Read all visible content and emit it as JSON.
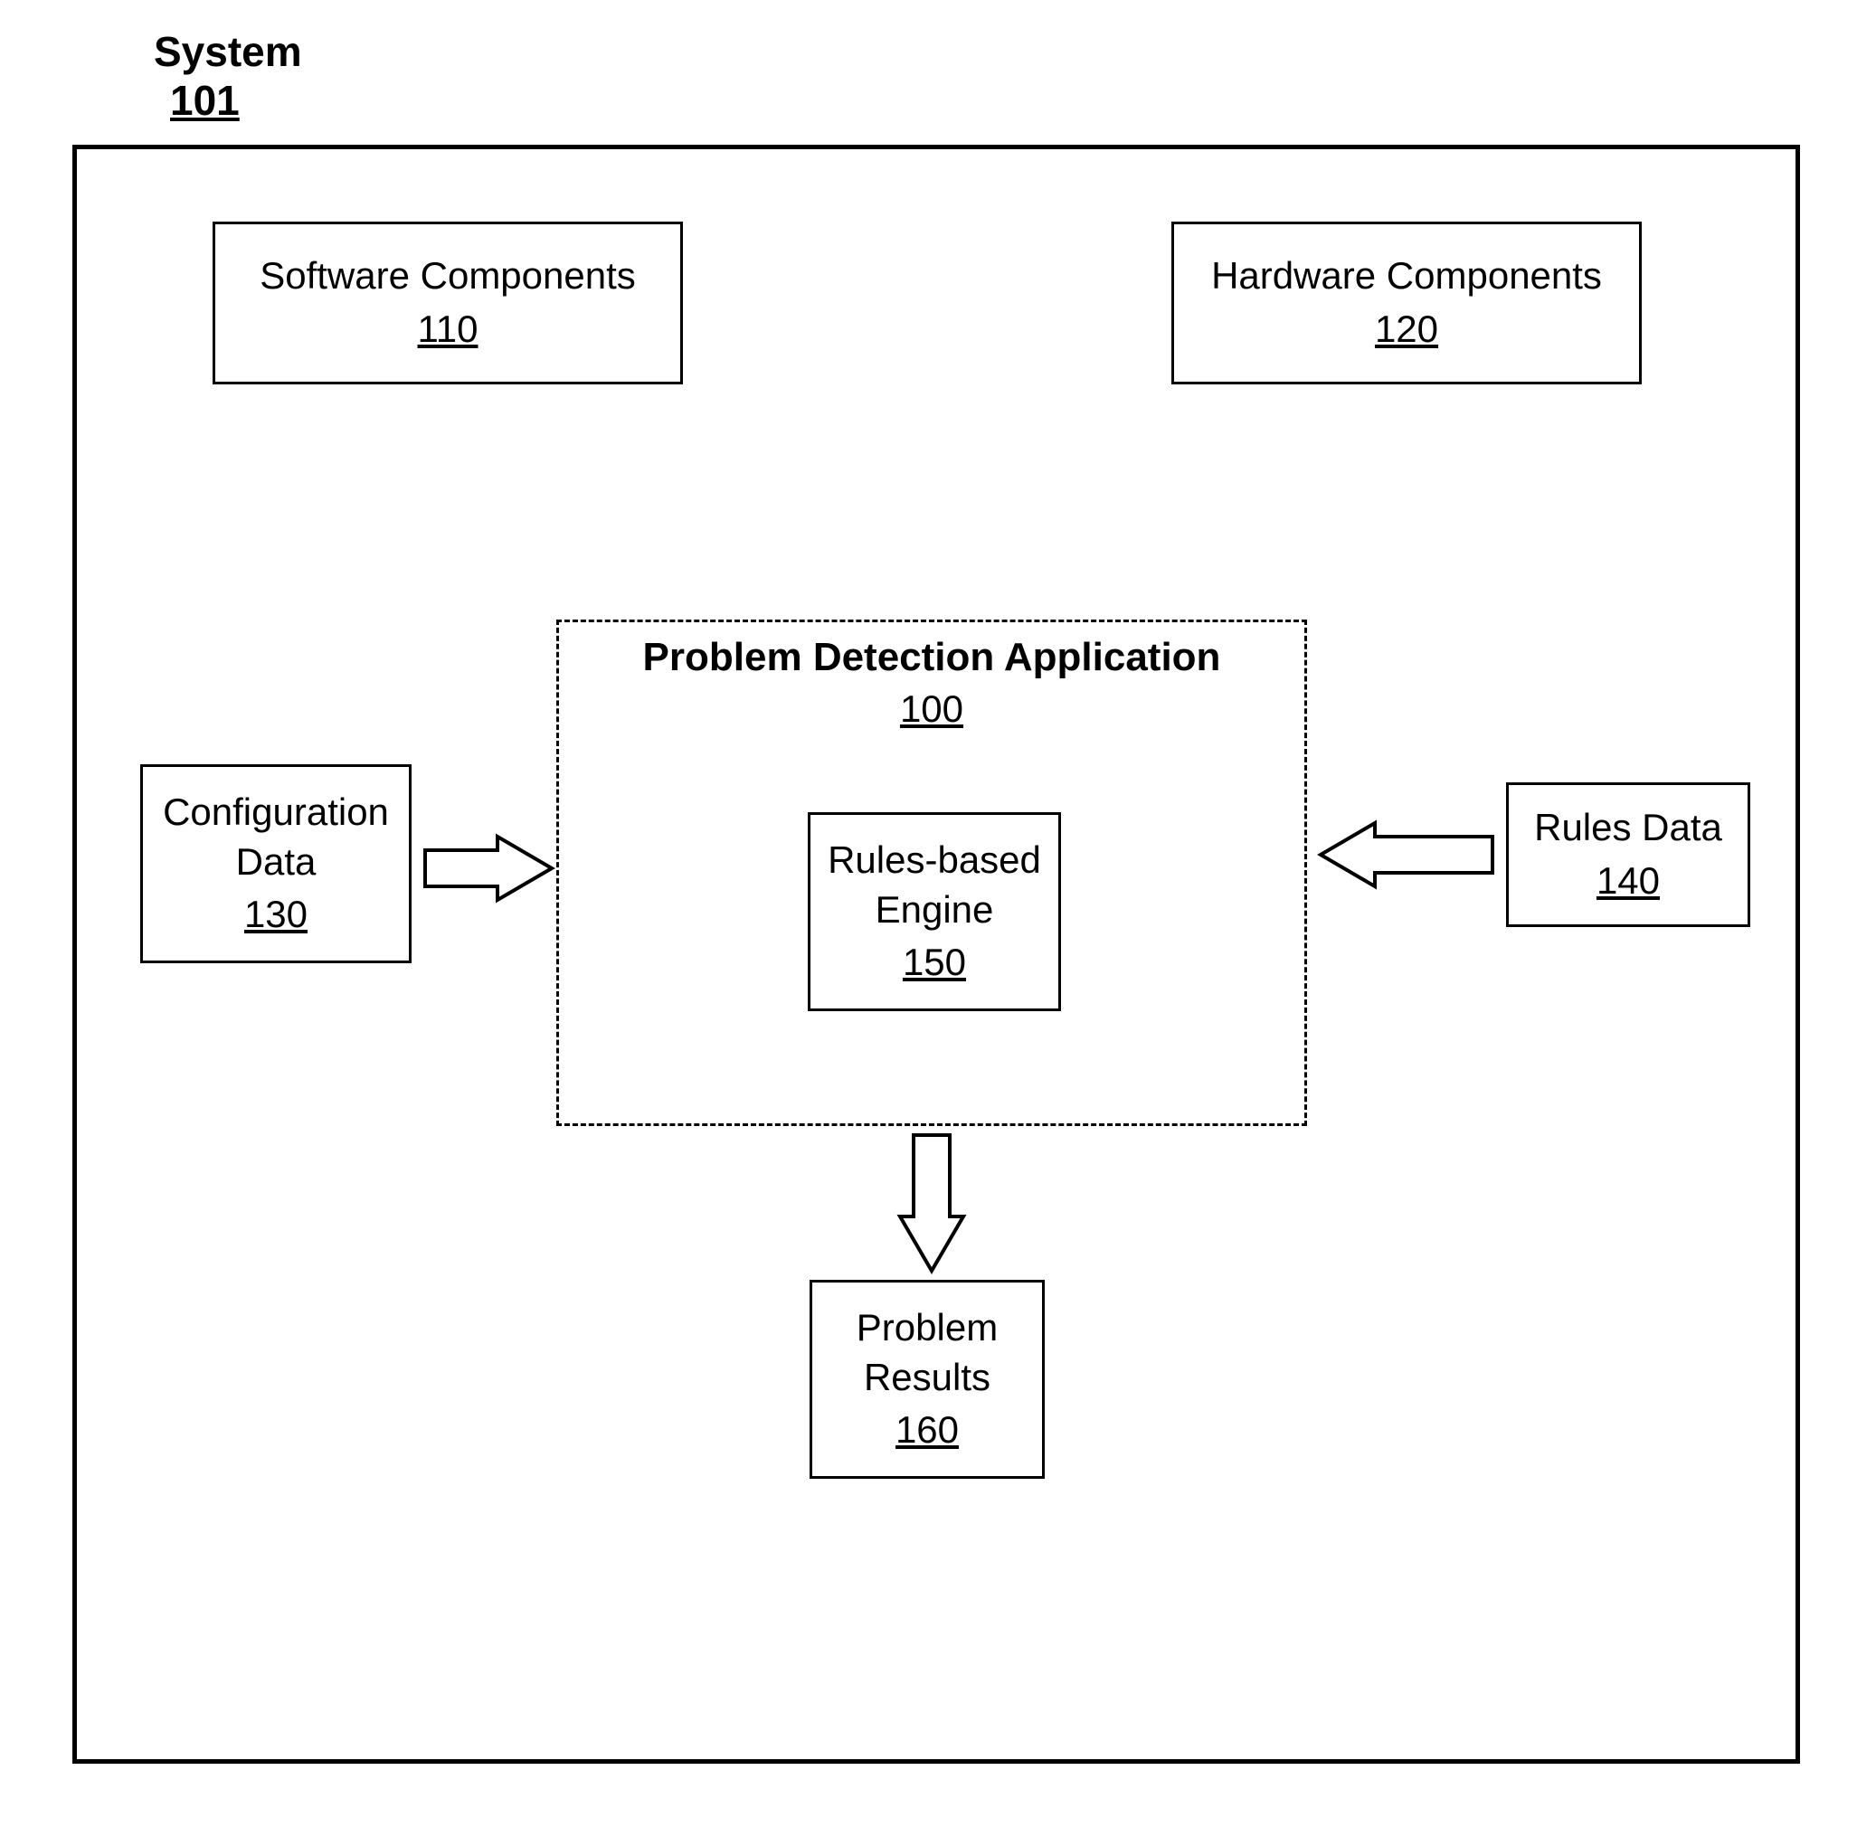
{
  "system": {
    "label": "System",
    "num": "101"
  },
  "software": {
    "label": "Software Components",
    "num": "110"
  },
  "hardware": {
    "label": "Hardware Components",
    "num": "120"
  },
  "config": {
    "label1": "Configuration",
    "label2": "Data",
    "num": "130"
  },
  "rules": {
    "label": "Rules Data",
    "num": "140"
  },
  "app": {
    "label": "Problem Detection Application",
    "num": "100"
  },
  "engine": {
    "label1": "Rules-based",
    "label2": "Engine",
    "num": "150"
  },
  "results": {
    "label1": "Problem",
    "label2": "Results",
    "num": "160"
  }
}
